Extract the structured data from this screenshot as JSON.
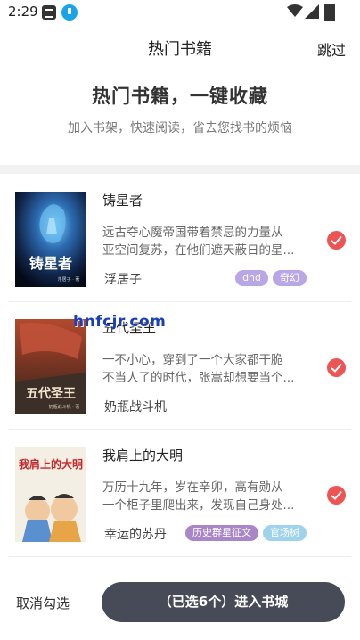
{
  "status_bar": {
    "time": "2:29",
    "icons": [
      "app-notification-icon",
      "download-icon",
      "wifi-icon",
      "signal-icon",
      "battery-icon"
    ]
  },
  "header": {
    "title": "热门书籍",
    "skip_label": "跳过"
  },
  "hero": {
    "title": "热门书籍，一键收藏",
    "subtitle": "加入书架，快速阅读，省去您找书的烦恼"
  },
  "books": [
    {
      "title": "铸星者",
      "desc_line1": "远古夺心魔帝国带着禁忌的力量从",
      "desc_line2": "亚空间复苏，在他们遮天蔽日的星...",
      "author": "浮居子",
      "tags": [
        "dnd",
        "奇幻"
      ],
      "cover_text": "铸星者",
      "cover_author": "浮居子 · 著",
      "checked": true
    },
    {
      "title": "五代圣王",
      "desc_line1": "一不小心，穿到了一个大家都干脆",
      "desc_line2": "不当人了的时代，张嵩却想要当个...",
      "author": "奶瓶战斗机",
      "tags": [],
      "cover_text": "五代圣王",
      "cover_author": "奶瓶战斗机 · 著",
      "checked": true
    },
    {
      "title": "我肩上的大明",
      "desc_line1": "万历十九年，岁在辛卯，高有勋从",
      "desc_line2": "一个柜子里爬出来，发现自己身处...",
      "author": "幸运的苏丹",
      "tags": [
        "历史群星征文",
        "官场树"
      ],
      "cover_text": "我肩上的大明",
      "checked": true
    }
  ],
  "watermark": "hnfcjr.com",
  "footer": {
    "cancel_label": "取消勾选",
    "enter_label": "（已选6个）进入书城"
  },
  "colors": {
    "check_red": "#ed5555",
    "tag_purple": "#b9a6e6",
    "tag_history": "#a886c7",
    "tag_blue": "#9fd3ec",
    "button_dark": "#474a57",
    "hero_gray": "#333333"
  }
}
